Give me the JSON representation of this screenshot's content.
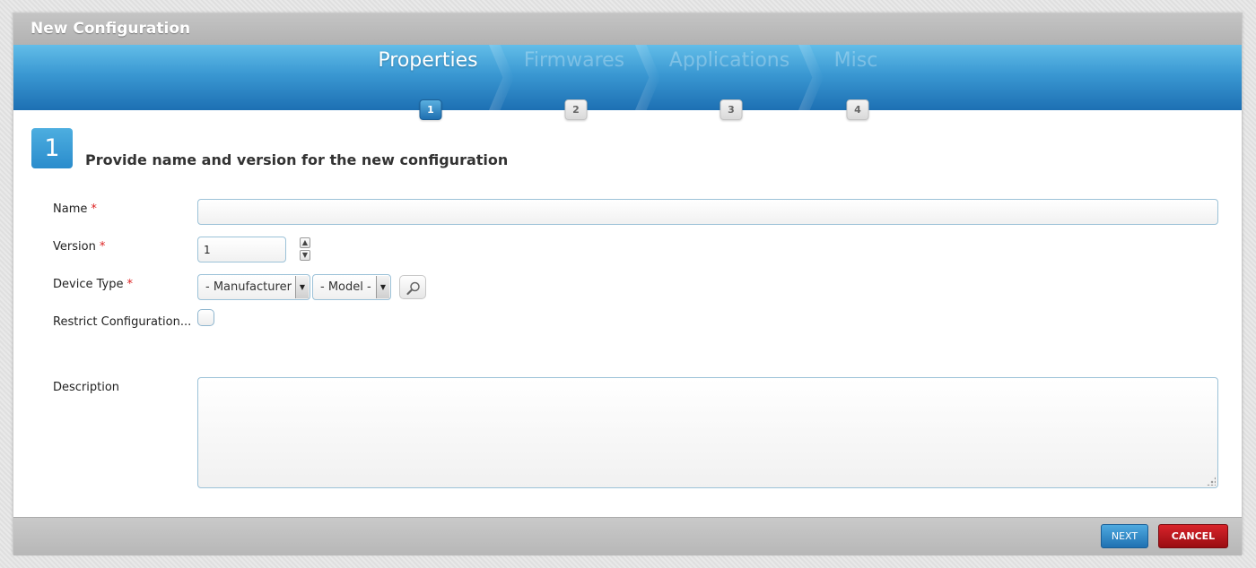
{
  "dialog": {
    "title": "New Configuration"
  },
  "steps": [
    {
      "label": "Properties",
      "number": "1"
    },
    {
      "label": "Firmwares",
      "number": "2"
    },
    {
      "label": "Applications",
      "number": "3"
    },
    {
      "label": "Misc",
      "number": "4"
    }
  ],
  "current_step": {
    "number": "1",
    "heading": "Provide name and version for the new configuration"
  },
  "form": {
    "name": {
      "label": "Name",
      "value": "",
      "required_mark": "*"
    },
    "version": {
      "label": "Version",
      "value": "1",
      "required_mark": "*"
    },
    "device_type": {
      "label": "Device Type",
      "required_mark": "*",
      "manufacturer": "- Manufacturer -",
      "model": "- Model -"
    },
    "restrict": {
      "label": "Restrict Configuration...",
      "checked": false
    },
    "description": {
      "label": "Description",
      "value": ""
    }
  },
  "buttons": {
    "next": "NEXT",
    "cancel": "CANCEL"
  },
  "icons": {
    "spin_up": "chevron-up-icon",
    "spin_down": "chevron-down-icon",
    "dropdown": "triangle-down-icon",
    "search": "magnifier-icon"
  },
  "colors": {
    "accent_blue": "#2a8ccc",
    "cancel_red": "#b0141a",
    "required": "#d22222"
  }
}
